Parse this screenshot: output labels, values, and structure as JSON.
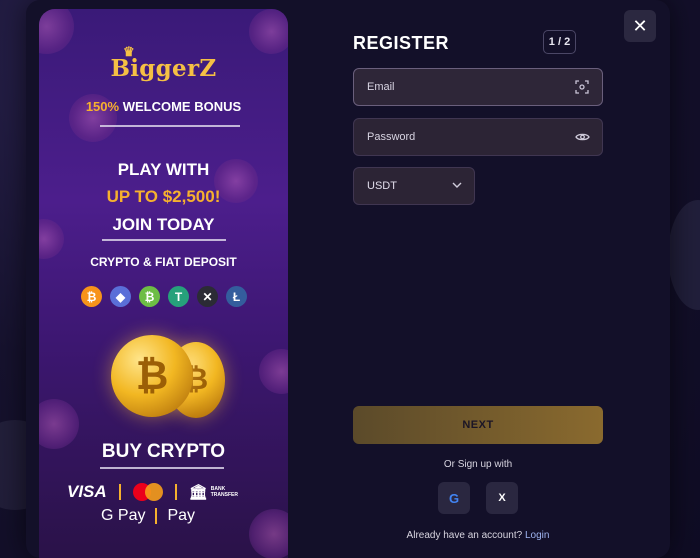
{
  "promo": {
    "brand": "BiggerZ",
    "bonus_label": "WELCOME BONUS",
    "bonus_pct": "150%",
    "headline_1": "PLAY WITH",
    "headline_2": "UP TO $2,500!",
    "headline_3": "JOIN TODAY",
    "deposit_label": "CRYPTO & FIAT DEPOSIT",
    "crypto_icons": [
      {
        "name": "bitcoin-icon",
        "glyph": "₿",
        "color": "#f7931a"
      },
      {
        "name": "ethereum-icon",
        "glyph": "◆",
        "color": "#5a6fd8"
      },
      {
        "name": "bitcoin-cash-icon",
        "glyph": "₿",
        "color": "#6dbd45"
      },
      {
        "name": "tether-icon",
        "glyph": "T",
        "color": "#26a17b"
      },
      {
        "name": "xrp-icon",
        "glyph": "✕",
        "color": "#2b2b35"
      },
      {
        "name": "litecoin-icon",
        "glyph": "Ł",
        "color": "#345d9d"
      }
    ],
    "buy_label": "BUY CRYPTO",
    "pay_methods": {
      "visa": "VISA",
      "bank": "BANK TRANSFER",
      "gpay": "G Pay",
      "applepay": " Pay"
    }
  },
  "form": {
    "title": "REGISTER",
    "step": "1 / 2",
    "email_placeholder": "Email",
    "password_placeholder": "Password",
    "currency": "USDT",
    "next_label": "NEXT",
    "or_label": "Or Sign up with",
    "google_glyph": "G",
    "x_glyph": "X",
    "already_text": "Already have an account?",
    "login_label": "Login"
  },
  "close_glyph": "✕",
  "colors": {
    "gold": "#f6b12e",
    "promo_purple": "#4c1e8c",
    "panel_bg": "#131029",
    "field_bg": "#2c2435"
  }
}
